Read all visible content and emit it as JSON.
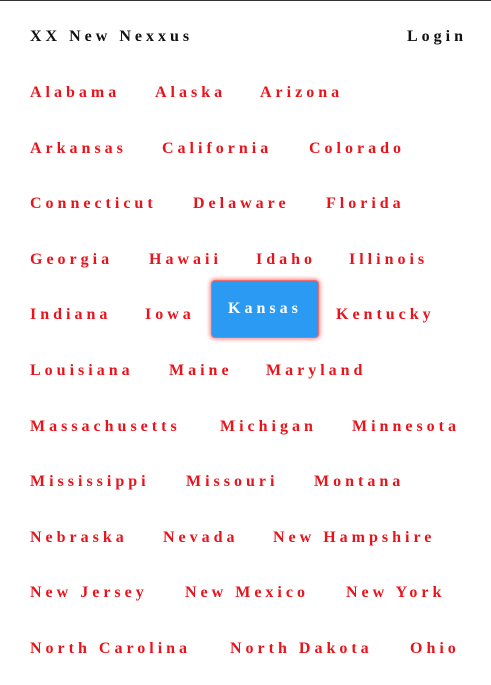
{
  "header": {
    "brand": "XX New Nexxus",
    "login_label": "Login"
  },
  "colors": {
    "link": "#e8131b",
    "active_bg": "#2b9af3",
    "active_text": "#ffffff",
    "focus_ring": "#f26a6a"
  },
  "states": [
    [
      "Alabama",
      "Alaska",
      "Arizona"
    ],
    [
      "Arkansas",
      "California",
      "Colorado"
    ],
    [
      "Connecticut",
      "Delaware",
      "Florida"
    ],
    [
      "Georgia",
      "Hawaii",
      "Idaho",
      "Illinois"
    ],
    [
      "Indiana",
      "Iowa",
      "Kansas",
      "Kentucky"
    ],
    [
      "Louisiana",
      "Maine",
      "Maryland"
    ],
    [
      "Massachusetts",
      "Michigan",
      "Minnesota"
    ],
    [
      "Mississippi",
      "Missouri",
      "Montana"
    ],
    [
      "Nebraska",
      "Nevada",
      "New Hampshire"
    ],
    [
      "New Jersey",
      "New Mexico",
      "New York"
    ],
    [
      "North Carolina",
      "North Dakota",
      "Ohio"
    ]
  ],
  "selected_state": "Kansas"
}
